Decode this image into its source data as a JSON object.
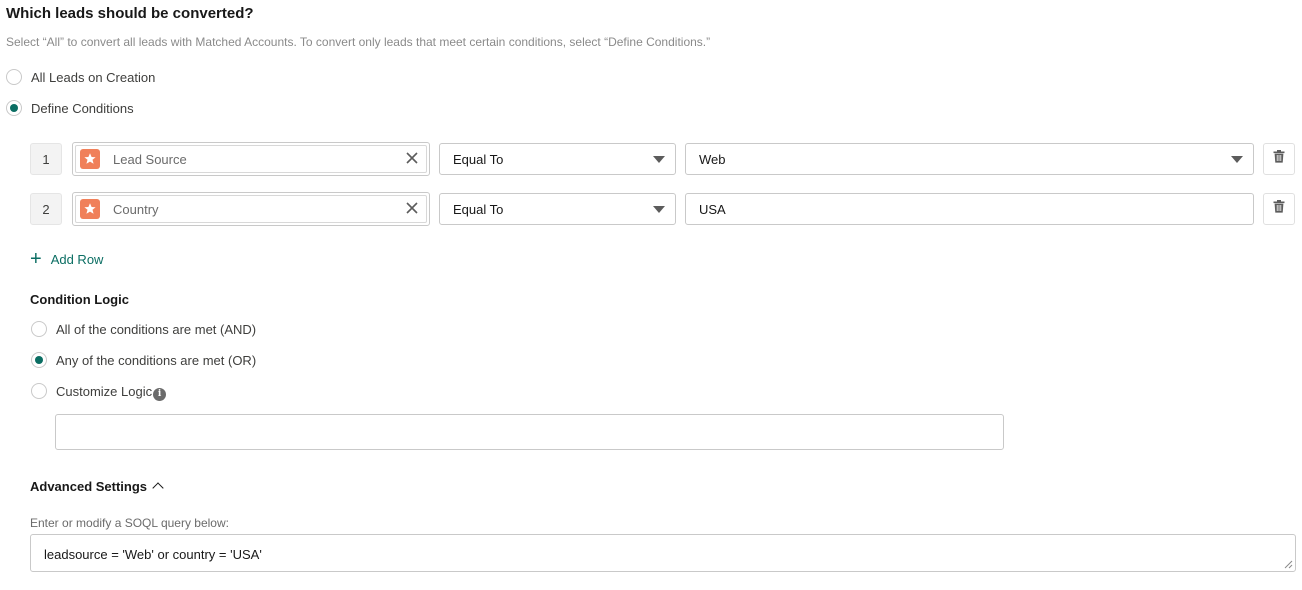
{
  "header": {
    "title": "Which leads should be converted?",
    "subtitle": "Select “All” to convert all leads with Matched Accounts. To convert only leads that meet certain conditions, select “Define Conditions.”"
  },
  "conversion_mode": {
    "options": [
      {
        "label": "All Leads on Creation",
        "selected": false
      },
      {
        "label": "Define Conditions",
        "selected": true
      }
    ]
  },
  "conditions": {
    "rows": [
      {
        "number": "1",
        "field": "Lead Source",
        "operator": "Equal To",
        "value": "Web",
        "value_is_dropdown": true
      },
      {
        "number": "2",
        "field": "Country",
        "operator": "Equal To",
        "value": "USA",
        "value_is_dropdown": false
      }
    ],
    "add_row_label": "Add Row"
  },
  "condition_logic": {
    "title": "Condition Logic",
    "options": [
      {
        "label": "All of the conditions are met (AND)",
        "selected": false
      },
      {
        "label": "Any of the conditions are met (OR)",
        "selected": true
      },
      {
        "label": "Customize Logic",
        "selected": false
      }
    ],
    "custom_logic_value": ""
  },
  "advanced": {
    "title": "Advanced Settings",
    "soql_label": "Enter or modify a SOQL query below:",
    "soql_value": "leadsource = 'Web' or country = 'USA'"
  },
  "colors": {
    "accent": "#0b6e63",
    "field_icon": "#f0805a"
  },
  "icons": {
    "field": "salesforce-field-icon",
    "clear": "close-icon",
    "delete": "trash-icon",
    "add": "plus-icon",
    "info": "info-icon",
    "collapse": "chevron-up-icon"
  }
}
